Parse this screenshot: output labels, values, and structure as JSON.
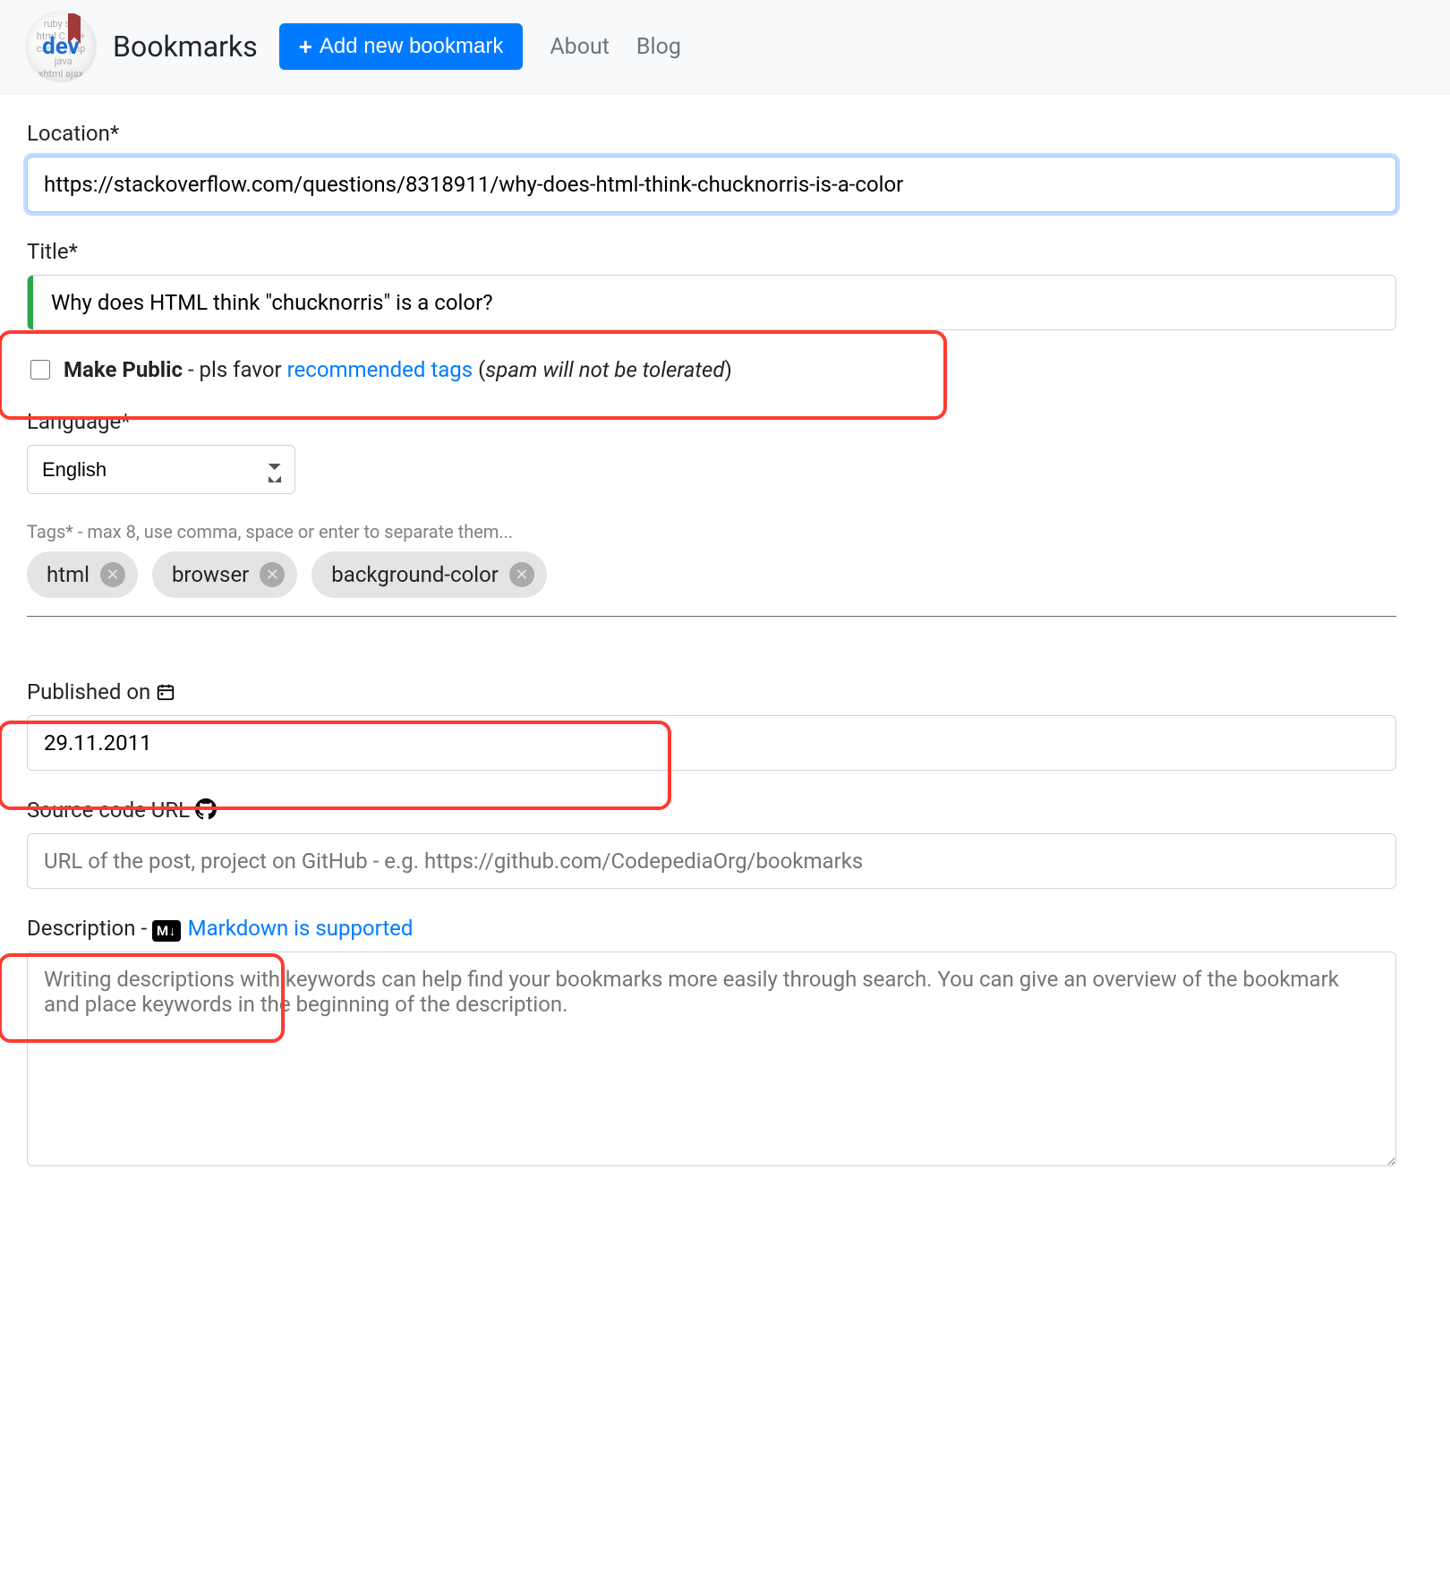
{
  "navbar": {
    "brand": "Bookmarks",
    "add_button": "Add new bookmark",
    "about": "About",
    "blog": "Blog",
    "logo_text": "dev"
  },
  "form": {
    "location_label": "Location*",
    "location_value": "https://stackoverflow.com/questions/8318911/why-does-html-think-chucknorris-is-a-color",
    "title_label": "Title*",
    "title_value": "Why does HTML think \"chucknorris\" is a color?",
    "make_public_label": "Make Public",
    "make_public_mid": " - pls favor ",
    "recommended_tags": "recommended tags",
    "spam_note_open": " (",
    "spam_note": "spam will not be tolerated",
    "spam_note_close": ")",
    "language_label": "Language*",
    "language_value": "English",
    "tags_hint": "Tags* - max 8, use comma, space or enter to separate them...",
    "tags": [
      "html",
      "browser",
      "background-color"
    ],
    "published_label": "Published on ",
    "published_value": "29.11.2011",
    "source_label": "Source code URL ",
    "source_placeholder": "URL of the post, project on GitHub - e.g. https://github.com/CodepediaOrg/bookmarks",
    "description_label": "Description - ",
    "md_badge": "M↓",
    "markdown_link": "Markdown is supported",
    "description_placeholder": "Writing descriptions with keywords can help find your bookmarks more easily through search. You can give an overview of the bookmark and place keywords in the beginning of the description."
  }
}
